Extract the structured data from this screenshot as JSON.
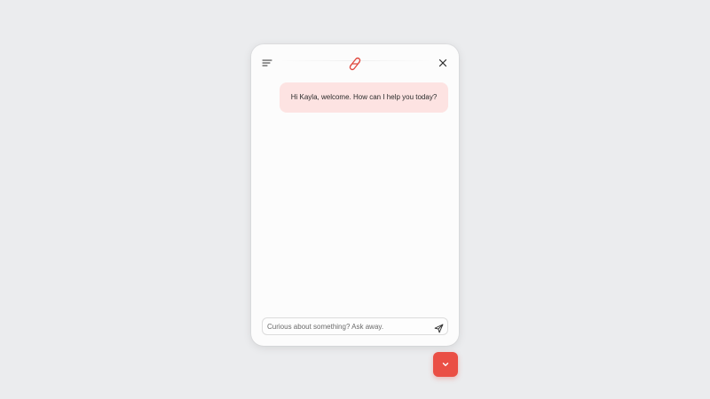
{
  "header": {
    "menu_icon": "menu-icon",
    "logo_icon": "brand-logo-icon",
    "close_icon": "close-icon"
  },
  "messages": [
    {
      "sender": "assistant",
      "text": "Hi Kayla, welcome. How can I help you today?"
    }
  ],
  "composer": {
    "placeholder": "Curious about something? Ask away.",
    "value": "",
    "send_icon": "send-icon"
  },
  "launcher": {
    "icon": "chevron-down-icon"
  },
  "colors": {
    "accent": "#ea4f45",
    "bubble_bg": "#fde3e2",
    "page_bg": "#ebecee",
    "window_bg": "#fcfcfc"
  }
}
